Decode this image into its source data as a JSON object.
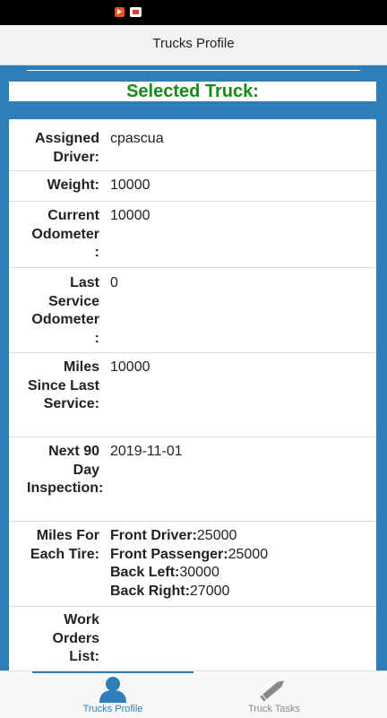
{
  "app": {
    "title": "Trucks Profile"
  },
  "banner": {
    "text": "Selected Truck:"
  },
  "colors": {
    "accent": "#2e7fb8",
    "banner_text": "#168b16",
    "active_tab": "#2e7fb8",
    "inactive_tab": "#888888"
  },
  "details": {
    "assigned_driver": {
      "label": "Assigned Driver:",
      "value": "cpascua"
    },
    "weight": {
      "label": "Weight:",
      "value": "10000"
    },
    "current_odometer": {
      "label": "Current Odometer :",
      "value": "10000"
    },
    "last_service_odometer": {
      "label": "Last Service Odometer :",
      "value": "0"
    },
    "miles_since_last_service": {
      "label": "Miles Since Last Service:",
      "value": "10000"
    },
    "next_inspection": {
      "label": "Next 90 Day Inspection:",
      "value": "2019-11-01"
    },
    "miles_for_each_tire": {
      "label": "Miles For Each Tire:",
      "tires": [
        {
          "name": "Front Driver:",
          "miles": "25000"
        },
        {
          "name": "Front Passenger:",
          "miles": "25000"
        },
        {
          "name": "Back Left:",
          "miles": "30000"
        },
        {
          "name": "Back Right:",
          "miles": "27000"
        }
      ]
    },
    "work_orders": {
      "label": "Work Orders List:"
    }
  },
  "tabs": [
    {
      "label": "Trucks Profile",
      "icon": "person-icon",
      "active": true
    },
    {
      "label": "Truck Tasks",
      "icon": "pencil-icon",
      "active": false
    }
  ]
}
